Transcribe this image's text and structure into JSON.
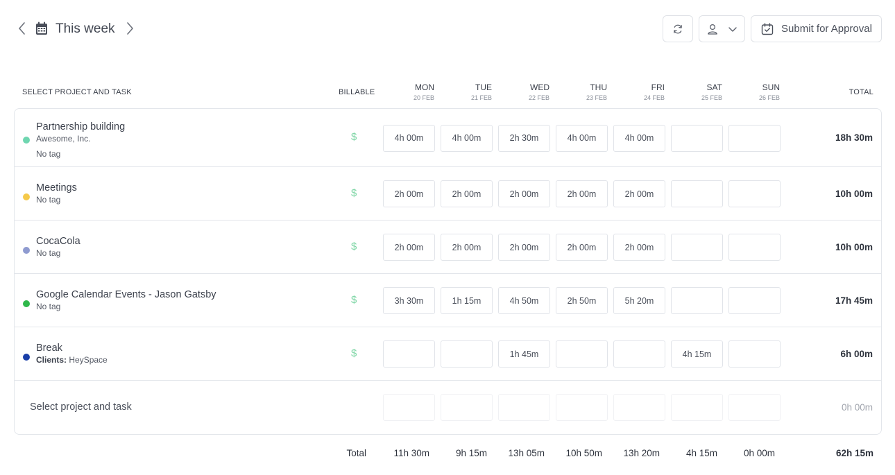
{
  "header": {
    "week_label": "This week",
    "submit_label": "Submit for Approval"
  },
  "columns": {
    "project": "SELECT PROJECT AND TASK",
    "billable": "BILLABLE",
    "total": "TOTAL",
    "days": [
      {
        "name": "MON",
        "date": "20 FEB"
      },
      {
        "name": "TUE",
        "date": "21 FEB"
      },
      {
        "name": "WED",
        "date": "22 FEB"
      },
      {
        "name": "THU",
        "date": "23 FEB"
      },
      {
        "name": "FRI",
        "date": "24 FEB"
      },
      {
        "name": "SAT",
        "date": "25 FEB"
      },
      {
        "name": "SUN",
        "date": "26 FEB"
      }
    ]
  },
  "rows": [
    {
      "name": "Partnership building",
      "client": "Awesome, Inc.",
      "tag": "No tag",
      "color": "#6fd6b0",
      "billable": "$",
      "times": [
        "4h 00m",
        "4h 00m",
        "2h 30m",
        "4h 00m",
        "4h 00m",
        "",
        ""
      ],
      "total": "18h 30m"
    },
    {
      "name": "Meetings",
      "tag": "No tag",
      "color": "#f5c94a",
      "billable": "$",
      "times": [
        "2h 00m",
        "2h 00m",
        "2h 00m",
        "2h 00m",
        "2h 00m",
        "",
        ""
      ],
      "total": "10h 00m"
    },
    {
      "name": "CocaCola",
      "tag": "No tag",
      "color": "#8f9bd0",
      "billable": "$",
      "times": [
        "2h 00m",
        "2h 00m",
        "2h 00m",
        "2h 00m",
        "2h 00m",
        "",
        ""
      ],
      "total": "10h 00m"
    },
    {
      "name": "Google Calendar Events - Jason Gatsby",
      "tag": "No tag",
      "color": "#2fb84a",
      "billable": "$",
      "times": [
        "3h 30m",
        "1h 15m",
        "4h 50m",
        "2h 50m",
        "5h 20m",
        "",
        ""
      ],
      "total": "17h 45m"
    },
    {
      "name": "Break",
      "client_label": "Clients:",
      "client_value": "HeySpace",
      "color": "#1a3fa8",
      "billable": "$",
      "times": [
        "",
        "",
        "1h 45m",
        "",
        "",
        "4h 15m",
        ""
      ],
      "total": "6h 00m"
    }
  ],
  "empty_row": {
    "placeholder": "Select project and task",
    "total": "0h 00m"
  },
  "footer": {
    "label": "Total",
    "days": [
      "11h 30m",
      "9h 15m",
      "13h 05m",
      "10h 50m",
      "13h 20m",
      "4h 15m",
      "0h 00m"
    ],
    "grand_total": "62h 15m"
  }
}
